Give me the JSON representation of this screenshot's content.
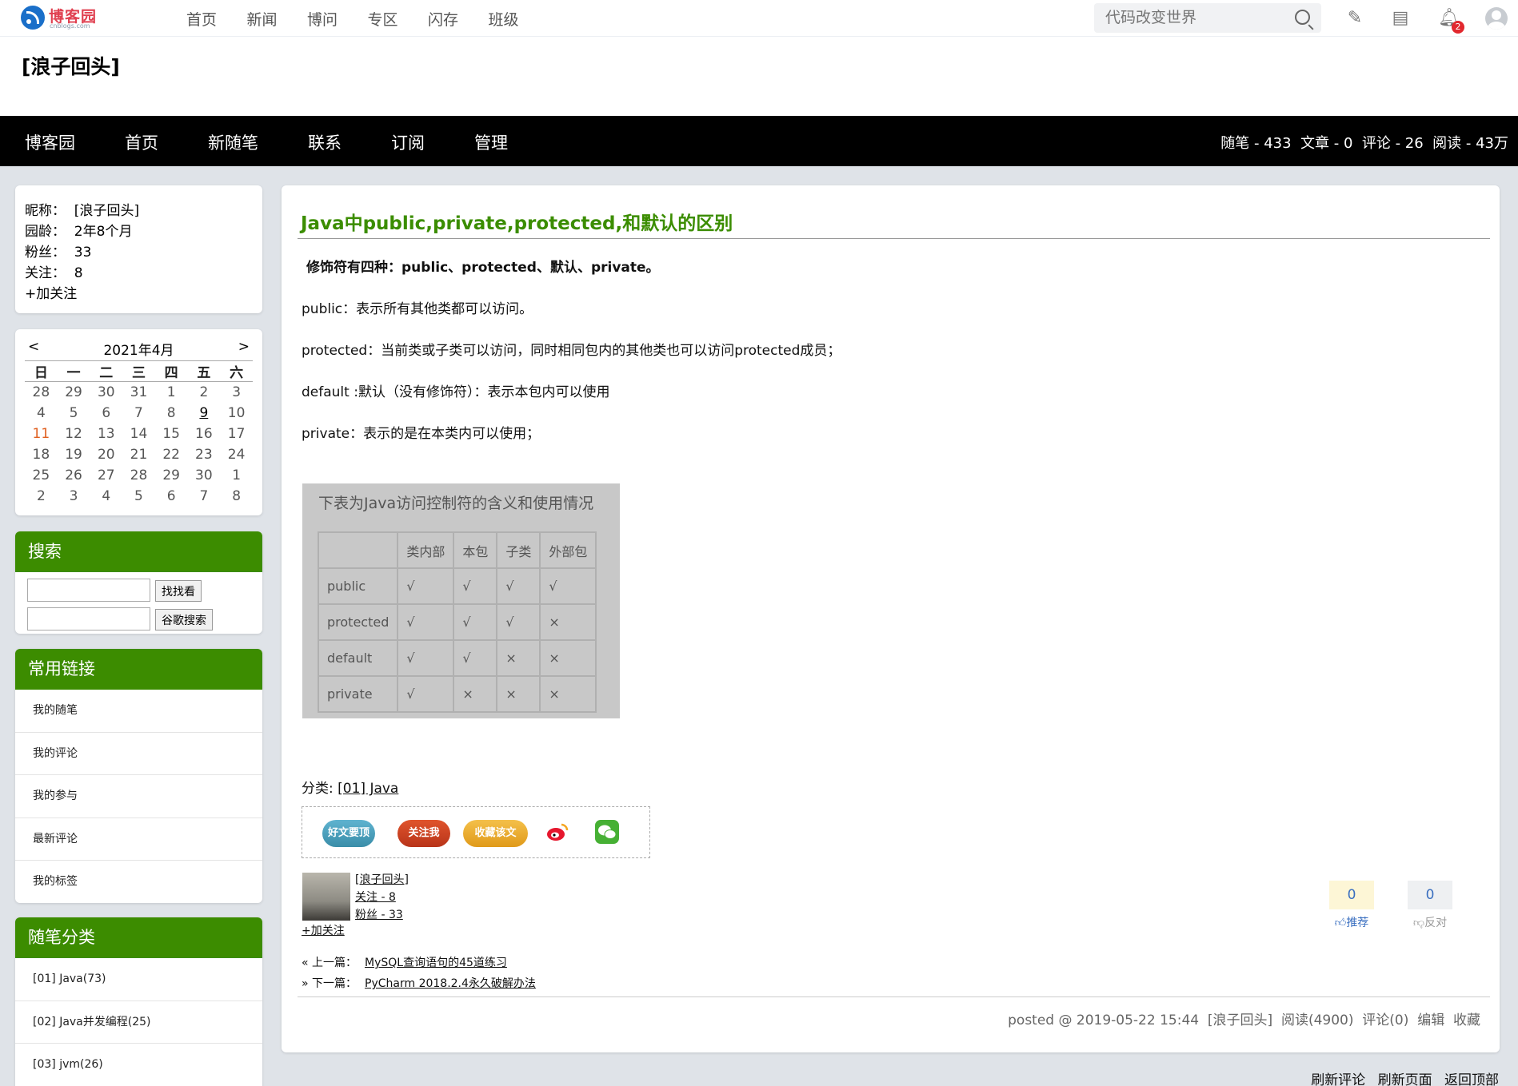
{
  "topnav": {
    "logo_text": "博客园",
    "logo_domain": "cnblogs.com",
    "links": [
      "首页",
      "新闻",
      "博问",
      "专区",
      "闪存",
      "班级"
    ],
    "search_placeholder": "代码改变世界",
    "notification_count": "2"
  },
  "header": {
    "blog_title": "[浪子回头]"
  },
  "navbar": {
    "links": [
      "博客园",
      "首页",
      "新随笔",
      "联系",
      "订阅",
      "管理"
    ],
    "stats": "随笔 - 433  文章 - 0  评论 - 26  阅读 - 43万"
  },
  "profile": {
    "nickname": "昵称：  [浪子回头]",
    "age": "园龄：  2年8个月",
    "fans": "粉丝：  33",
    "follow": "关注：  8",
    "add_follow": "+加关注"
  },
  "calendar": {
    "prev": "<",
    "title": "2021年4月",
    "next": ">",
    "weekdays": [
      "日",
      "一",
      "二",
      "三",
      "四",
      "五",
      "六"
    ],
    "weeks": [
      [
        "28",
        "29",
        "30",
        "31",
        "1",
        "2",
        "3"
      ],
      [
        "4",
        "5",
        "6",
        "7",
        "8",
        "9",
        "10"
      ],
      [
        "11",
        "12",
        "13",
        "14",
        "15",
        "16",
        "17"
      ],
      [
        "18",
        "19",
        "20",
        "21",
        "22",
        "23",
        "24"
      ],
      [
        "25",
        "26",
        "27",
        "28",
        "29",
        "30",
        "1"
      ],
      [
        "2",
        "3",
        "4",
        "5",
        "6",
        "7",
        "8"
      ]
    ]
  },
  "search": {
    "title": "搜索",
    "button1": "找找看",
    "button2": "谷歌搜索"
  },
  "links": {
    "title": "常用链接",
    "items": [
      "我的随笔",
      "我的评论",
      "我的参与",
      "最新评论",
      "我的标签"
    ]
  },
  "categories": {
    "title": "随笔分类",
    "items": [
      "[01] Java(73)",
      "[02] Java并发编程(25)",
      "[03] jvm(26)"
    ]
  },
  "post": {
    "title": "Java中public,private,protected,和默认的区别",
    "lead": "修饰符有四种：public、protected、默认、private。",
    "p1": "public：表示所有其他类都可以访问。",
    "p2": "protected：当前类或子类可以访问，同时相同包内的其他类也可以访问protected成员；",
    "p3": "default :默认（没有修饰符）：表示本包内可以使用",
    "p4": "private：表示的是在本类内可以使用；",
    "table_caption": "下表为Java访问控制符的含义和使用情况",
    "table_headers": [
      "",
      "类内部",
      "本包",
      "子类",
      "外部包"
    ],
    "table_rows": [
      [
        "public",
        "√",
        "√",
        "√",
        "√"
      ],
      [
        "protected",
        "√",
        "√",
        "√",
        "×"
      ],
      [
        "default",
        "√",
        "√",
        "×",
        "×"
      ],
      [
        "private",
        "√",
        "×",
        "×",
        "×"
      ]
    ],
    "category_label": "分类: ",
    "category_link": "[01] Java",
    "share_buttons": [
      "好文要顶",
      "关注我",
      "收藏该文"
    ],
    "author_name": "[浪子回头]",
    "author_follow": "关注 - 8",
    "author_fans": "粉丝 - 33",
    "author_add_follow": "+加关注",
    "recommend_count": "0",
    "recommend_label": "推荐",
    "oppose_count": "0",
    "oppose_label": "反对",
    "prev_label": "« 上一篇：",
    "prev_title": "MySQL查询语句的45道练习",
    "next_label": "» 下一篇：",
    "next_title": "PyCharm 2018.2.4永久破解办法",
    "posted": "posted @ 2019-05-22 15:44  [浪子回头]  阅读(4900)  评论(0)  编辑  收藏"
  },
  "footer": [
    "刷新评论",
    "刷新页面",
    "返回顶部"
  ],
  "colors": {
    "accent_green": "#3c8c00",
    "title_green": "#3b8d00",
    "navbar": "#000000"
  }
}
